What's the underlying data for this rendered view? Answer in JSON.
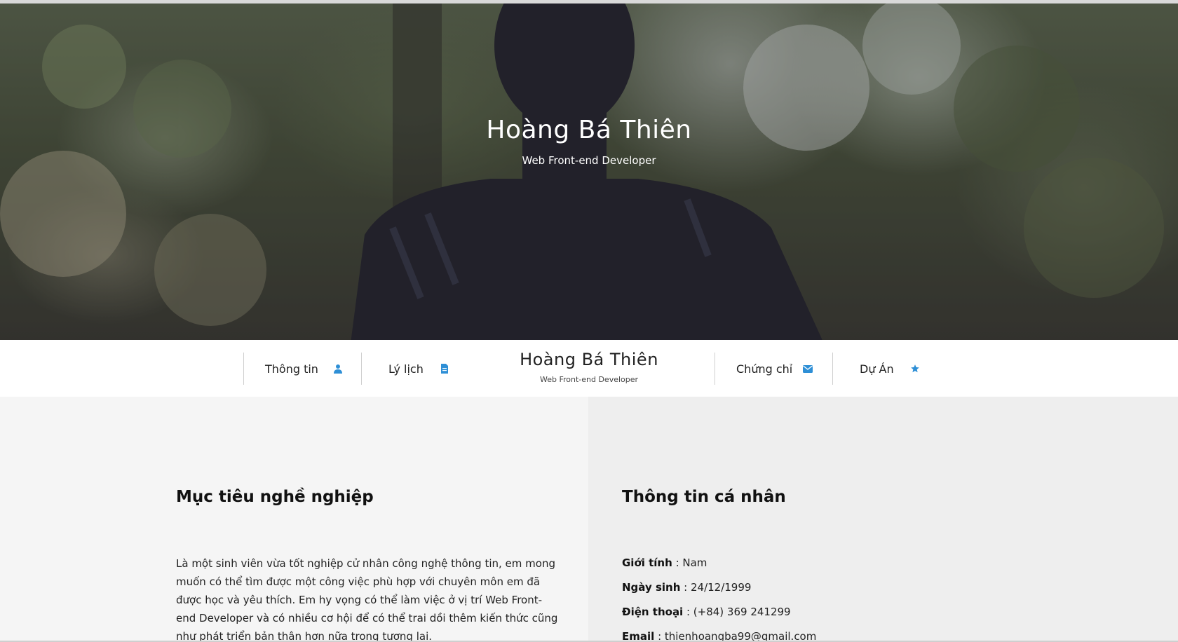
{
  "colors": {
    "accent": "#2e8fd6",
    "text_dark": "#111111",
    "left_panel": "#f5f5f5",
    "right_panel": "#eeeeee"
  },
  "hero": {
    "title": "Hoàng Bá Thiên",
    "subtitle": "Web Front-end Developer"
  },
  "nav": {
    "items": [
      {
        "label": "Thông tin",
        "icon": "user-icon"
      },
      {
        "label": "Lý lịch",
        "icon": "document-icon"
      },
      {
        "label": "Chứng chỉ",
        "icon": "envelope-icon"
      },
      {
        "label": "Dự Án",
        "icon": "star-icon"
      }
    ],
    "brand_name": "Hoàng Bá Thiên",
    "brand_subtitle": "Web Front-end Developer"
  },
  "objective": {
    "heading": "Mục tiêu nghề nghiệp",
    "text": "Là một sinh viên vừa tốt nghiệp cử nhân công nghệ thông tin, em mong muốn có thể tìm được một công việc phù hợp với chuyên môn em đã được học và yêu thích. Em hy vọng có thể làm việc ở vị trí Web Front-end Developer và có nhiều cơ hội để có thể trai dồi thêm kiến thức cũng như phát triển bản thân hơn nữa trong tương lai."
  },
  "personal_info": {
    "heading": "Thông tin cá nhân",
    "fields": [
      {
        "key": "Giới tính",
        "value": "Nam"
      },
      {
        "key": "Ngày sinh",
        "value": "24/12/1999"
      },
      {
        "key": "Điện thoại",
        "value": "(+84) 369 241299"
      },
      {
        "key": "Email",
        "value": "thienhoangba99@gmail.com"
      }
    ]
  }
}
